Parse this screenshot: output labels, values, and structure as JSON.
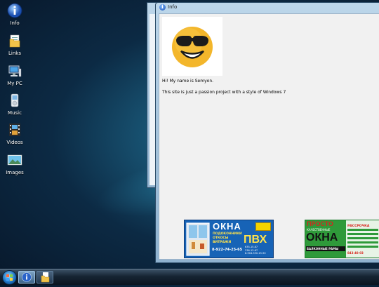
{
  "desktop": {
    "icons": [
      {
        "label": "Info",
        "icon": "info-icon"
      },
      {
        "label": "Links",
        "icon": "folder-links-icon"
      },
      {
        "label": "My PC",
        "icon": "computer-icon"
      },
      {
        "label": "Music",
        "icon": "music-player-icon"
      },
      {
        "label": "Videos",
        "icon": "film-icon"
      },
      {
        "label": "Images",
        "icon": "landscape-image-icon"
      }
    ]
  },
  "window": {
    "title": "Info",
    "paragraph1": "Hi! My name is Semyon.",
    "paragraph2": "This site is just a passion project with a style of Windows 7"
  },
  "ads": {
    "ad1": {
      "headline": "ОКНА",
      "subheadline": "ПВХ",
      "bullets": [
        "ПОДОКОННИКИ",
        "ОТКОСЫ",
        "ВИТРАЖИ"
      ],
      "phone": "8-922-74-25-65",
      "phones_small": [
        "635-15-87",
        "236-13-67",
        "8-904-330-15-90"
      ]
    },
    "ad2": {
      "top": "ПРОСТО",
      "tagline": "КАЧЕСТВЕННЫЕ",
      "headline": "ОКНА",
      "footer": "БАЛКОННЫЕ РАМЫ",
      "side_top": "РАССРОЧКА",
      "phone": "843-40-03"
    }
  },
  "colors": {
    "desktop_bg": "#0c2a44",
    "window_frame": "#a9c6de",
    "ad1_bg": "#1763b6",
    "ad1_accent": "#f5d400",
    "ad2_green": "#2f9a3a",
    "ad2_red": "#d7241c"
  },
  "taskbar": {
    "buttons": [
      {
        "name": "start-orb"
      },
      {
        "name": "info-task",
        "icon": "info-icon",
        "active": true
      },
      {
        "name": "links-task",
        "icon": "folder-links-icon",
        "active": false
      }
    ]
  }
}
